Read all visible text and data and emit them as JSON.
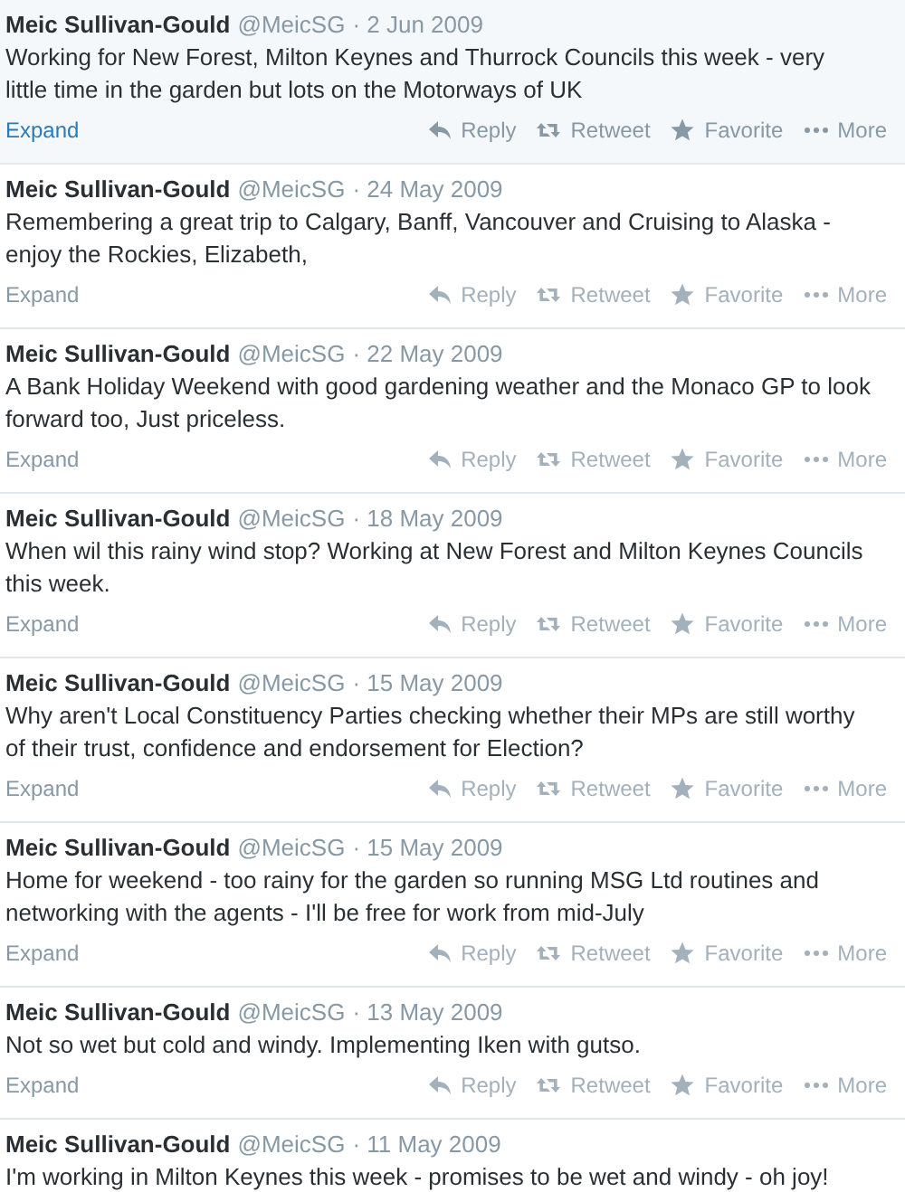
{
  "tweets": [
    {
      "name": "Meic Sullivan-Gould",
      "handle": "@MeicSG",
      "date": "· 2 Jun 2009",
      "text": "Working for New Forest, Milton Keynes and Thurrock Councils this week - very little time in the garden but lots on the Motorways of UK",
      "hovered": true,
      "expand": "Expand",
      "actions": [
        {
          "kind": "reply",
          "label": "Reply"
        },
        {
          "kind": "retweet",
          "label": "Retweet"
        },
        {
          "kind": "favorite",
          "label": "Favorite"
        },
        {
          "kind": "more",
          "label": "More"
        }
      ]
    },
    {
      "name": "Meic Sullivan-Gould",
      "handle": "@MeicSG",
      "date": "· 24 May 2009",
      "text": "Remembering a great trip to Calgary, Banff, Vancouver and Cruising to Alaska - enjoy the Rockies, Elizabeth,",
      "hovered": false,
      "expand": "Expand",
      "actions": [
        {
          "kind": "reply",
          "label": "Reply"
        },
        {
          "kind": "retweet",
          "label": "Retweet"
        },
        {
          "kind": "favorite",
          "label": "Favorite"
        },
        {
          "kind": "more",
          "label": "More"
        }
      ]
    },
    {
      "name": "Meic Sullivan-Gould",
      "handle": "@MeicSG",
      "date": "· 22 May 2009",
      "text": "A Bank Holiday Weekend with good gardening weather and the Monaco GP to look forward too,  Just priceless.",
      "hovered": false,
      "expand": "Expand",
      "actions": [
        {
          "kind": "reply",
          "label": "Reply"
        },
        {
          "kind": "retweet",
          "label": "Retweet"
        },
        {
          "kind": "favorite",
          "label": "Favorite"
        },
        {
          "kind": "more",
          "label": "More"
        }
      ]
    },
    {
      "name": "Meic Sullivan-Gould",
      "handle": "@MeicSG",
      "date": "· 18 May 2009",
      "text": "When wil this rainy wind stop?  Working at New Forest and Milton Keynes Councils this week.",
      "hovered": false,
      "expand": "Expand",
      "actions": [
        {
          "kind": "reply",
          "label": "Reply"
        },
        {
          "kind": "retweet",
          "label": "Retweet"
        },
        {
          "kind": "favorite",
          "label": "Favorite"
        },
        {
          "kind": "more",
          "label": "More"
        }
      ]
    },
    {
      "name": "Meic Sullivan-Gould",
      "handle": "@MeicSG",
      "date": "· 15 May 2009",
      "text": "Why aren't Local Constituency Parties checking whether their MPs are still worthy of their trust, confidence and endorsement for Election?",
      "hovered": false,
      "expand": "Expand",
      "actions": [
        {
          "kind": "reply",
          "label": "Reply"
        },
        {
          "kind": "retweet",
          "label": "Retweet"
        },
        {
          "kind": "favorite",
          "label": "Favorite"
        },
        {
          "kind": "more",
          "label": "More"
        }
      ]
    },
    {
      "name": "Meic Sullivan-Gould",
      "handle": "@MeicSG",
      "date": "· 15 May 2009",
      "text": "Home for weekend - too rainy for the garden so running MSG Ltd routines and networking with the agents - I'll be free for work from mid-July",
      "hovered": false,
      "expand": "Expand",
      "actions": [
        {
          "kind": "reply",
          "label": "Reply"
        },
        {
          "kind": "retweet",
          "label": "Retweet"
        },
        {
          "kind": "favorite",
          "label": "Favorite"
        },
        {
          "kind": "more",
          "label": "More"
        }
      ]
    },
    {
      "name": "Meic Sullivan-Gould",
      "handle": "@MeicSG",
      "date": "· 13 May 2009",
      "text": "Not so wet but cold and windy.  Implementing Iken with gutso.",
      "hovered": false,
      "expand": "Expand",
      "actions": [
        {
          "kind": "reply",
          "label": "Reply"
        },
        {
          "kind": "retweet",
          "label": "Retweet"
        },
        {
          "kind": "favorite",
          "label": "Favorite"
        },
        {
          "kind": "more",
          "label": "More"
        }
      ]
    },
    {
      "name": "Meic Sullivan-Gould",
      "handle": "@MeicSG",
      "date": "· 11 May 2009",
      "text": "I'm working in Milton Keynes this week - promises to be wet and windy - oh joy!"
    }
  ]
}
